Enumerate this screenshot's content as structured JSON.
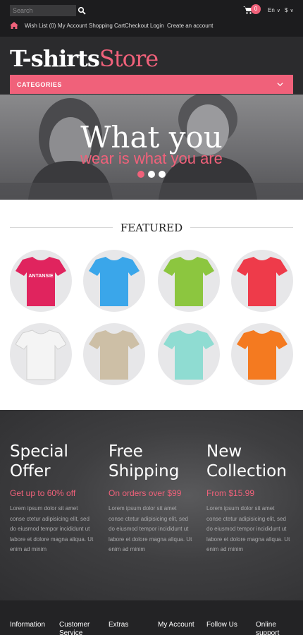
{
  "header": {
    "search_placeholder": "Search",
    "cart_count": "0",
    "language": "En",
    "currency": "$",
    "nav": [
      "Wish List (0)",
      "My Account",
      "Shopping Cart",
      "Checkout",
      "Login",
      "Create an account"
    ]
  },
  "logo": {
    "bold": "T-shirts",
    "light": "Store"
  },
  "categories_label": "CATEGORIES",
  "hero": {
    "title": "What you",
    "subtitle": "wear is what you are"
  },
  "featured": {
    "title": "FEATURED",
    "products": [
      {
        "color": "#e0245e",
        "print": "ANTANSIE"
      },
      {
        "color": "#3aa6ea"
      },
      {
        "color": "#8cc63f"
      },
      {
        "color": "#ee3b4a"
      },
      {
        "color": "#f4f4f4"
      },
      {
        "color": "#cdbfa6"
      },
      {
        "color": "#8fdcd2"
      },
      {
        "color": "#f47a20"
      }
    ]
  },
  "promos": [
    {
      "title_line1": "Special",
      "title_line2": "Offer",
      "sub": "Get up to 60% off",
      "text": "Lorem ipsum dolor sit amet conse ctetur adipisicing elit, sed do eiusmod tempor incididunt ut labore et dolore magna aliqua. Ut enim ad minim"
    },
    {
      "title_line1": "Free",
      "title_line2": "Shipping",
      "sub": "On orders over $99",
      "text": "Lorem ipsum dolor sit amet conse ctetur adipisicing elit, sed do eiusmod tempor incididunt ut labore et dolore magna aliqua. Ut enim ad minim"
    },
    {
      "title_line1": "New",
      "title_line2": "Collection",
      "sub": "From $15.99",
      "text": "Lorem ipsum dolor sit amet conse ctetur adipisicing elit, sed do eiusmod tempor incididunt ut labore et dolore magna aliqua. Ut enim ad minim"
    }
  ],
  "footer": [
    "Information",
    "Customer Service",
    "Extras",
    "My Account",
    "Follow Us",
    "Online support"
  ],
  "colors": {
    "accent": "#f0617a",
    "dark": "#2b2b2d"
  }
}
